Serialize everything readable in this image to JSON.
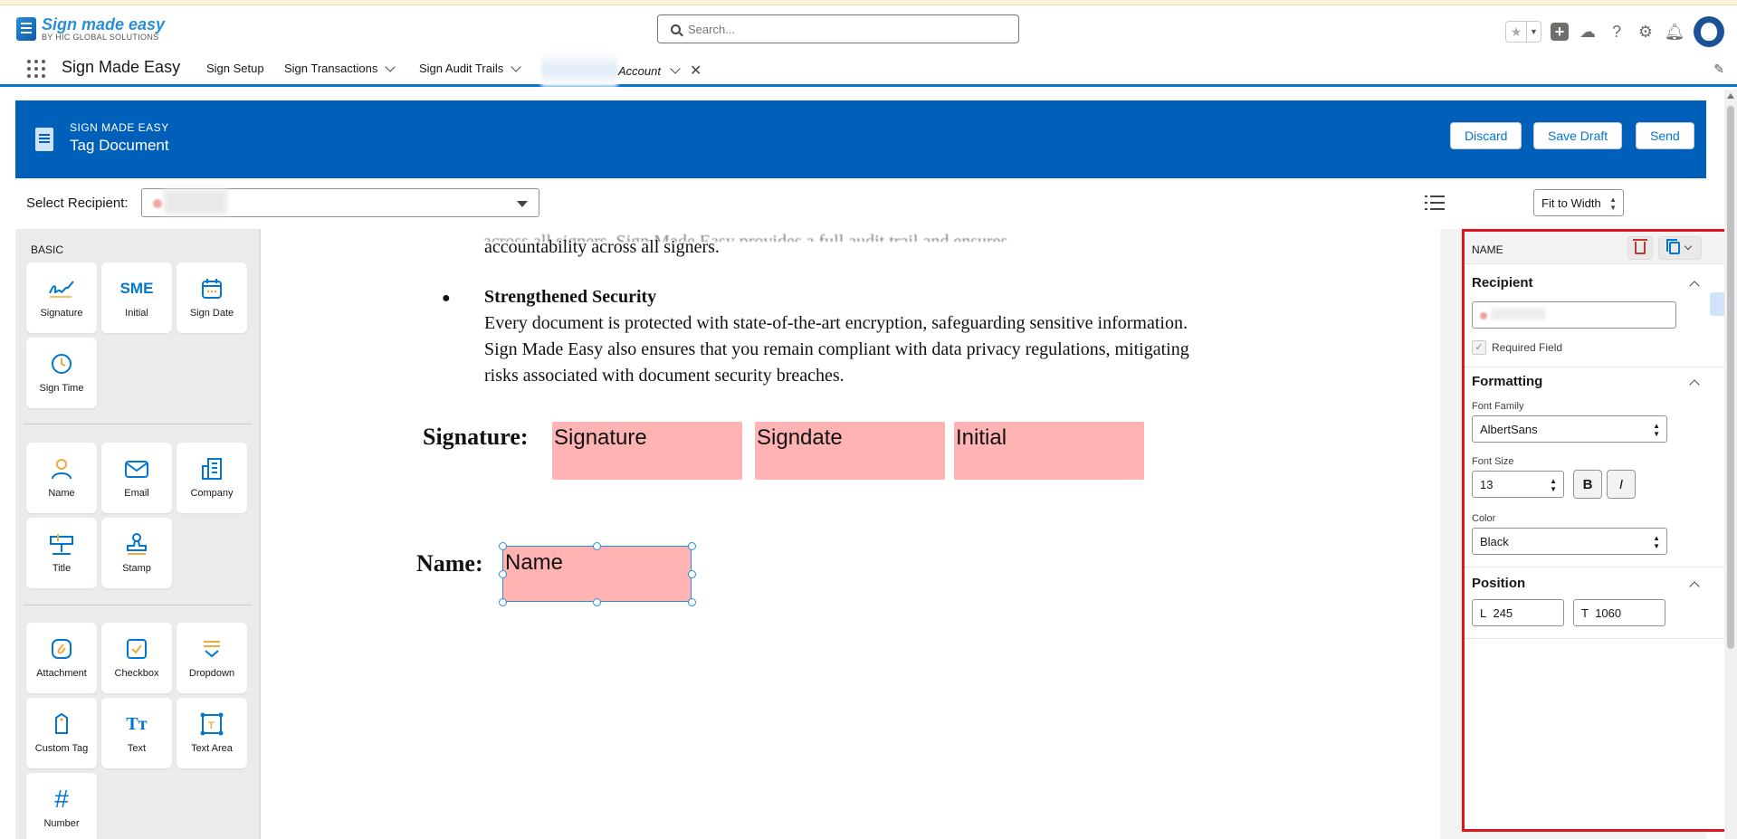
{
  "header": {
    "logo_title": "Sign made easy",
    "logo_subtitle": "BY HIC GLOBAL SOLUTIONS",
    "search_placeholder": "Search..."
  },
  "nav": {
    "app_name": "Sign Made Easy",
    "items": [
      {
        "label": "Sign Setup"
      },
      {
        "label": "Sign Transactions"
      },
      {
        "label": "Sign Audit Trails"
      }
    ],
    "open_tab": "Account"
  },
  "banner": {
    "kicker": "SIGN MADE EASY",
    "title": "Tag Document",
    "buttons": {
      "discard": "Discard",
      "save_draft": "Save Draft",
      "send": "Send"
    }
  },
  "toolbar": {
    "select_recipient_label": "Select Recipient:",
    "zoom_value": "Fit to Width"
  },
  "palette": {
    "section_label": "BASIC",
    "groups": [
      [
        {
          "label": "Signature",
          "icon": "signature-icon"
        },
        {
          "label": "Initial",
          "icon": "initial-icon",
          "glyph": "SME"
        },
        {
          "label": "Sign Date",
          "icon": "calendar-icon"
        },
        {
          "label": "Sign Time",
          "icon": "clock-icon"
        }
      ],
      [
        {
          "label": "Name",
          "icon": "person-icon"
        },
        {
          "label": "Email",
          "icon": "envelope-icon"
        },
        {
          "label": "Company",
          "icon": "building-icon"
        },
        {
          "label": "Title",
          "icon": "title-icon"
        },
        {
          "label": "Stamp",
          "icon": "stamp-icon"
        }
      ],
      [
        {
          "label": "Attachment",
          "icon": "paperclip-icon"
        },
        {
          "label": "Checkbox",
          "icon": "checkbox-icon"
        },
        {
          "label": "Dropdown",
          "icon": "dropdown-icon"
        },
        {
          "label": "Custom Tag",
          "icon": "tag-icon"
        },
        {
          "label": "Text",
          "icon": "text-icon",
          "glyph": "Tт"
        },
        {
          "label": "Text Area",
          "icon": "text-area-icon"
        },
        {
          "label": "Number",
          "icon": "hash-icon",
          "glyph": "#"
        }
      ]
    ]
  },
  "document": {
    "line_partial": "accountability across all signers.",
    "bullet_heading": "Strengthened Security",
    "bullet_lines": [
      "Every document is protected with state-of-the-art encryption, safeguarding sensitive information.",
      "Sign Made Easy also ensures that you remain compliant with data privacy regulations, mitigating",
      "risks associated with document security breaches."
    ],
    "signature_label": "Signature:",
    "name_label": "Name:",
    "fields": {
      "signature": "Signature",
      "signdate": "Signdate",
      "initial": "Initial",
      "name": "Name"
    }
  },
  "properties": {
    "header": "NAME",
    "recipient_section": "Recipient",
    "required_field_label": "Required Field",
    "required_checked": true,
    "formatting_section": "Formatting",
    "font_family_label": "Font Family",
    "font_family_value": "AlbertSans",
    "font_size_label": "Font Size",
    "font_size_value": "13",
    "bold_label": "B",
    "italic_label": "I",
    "color_label": "Color",
    "color_value": "Black",
    "position_section": "Position",
    "left_prefix": "L",
    "left_value": "245",
    "top_prefix": "T",
    "top_value": "1060"
  },
  "colors": {
    "brand_blue": "#005fb8",
    "accent": "#0176d3",
    "field_fill": "#ffb3b3",
    "selection_outline": "#e0161f"
  }
}
